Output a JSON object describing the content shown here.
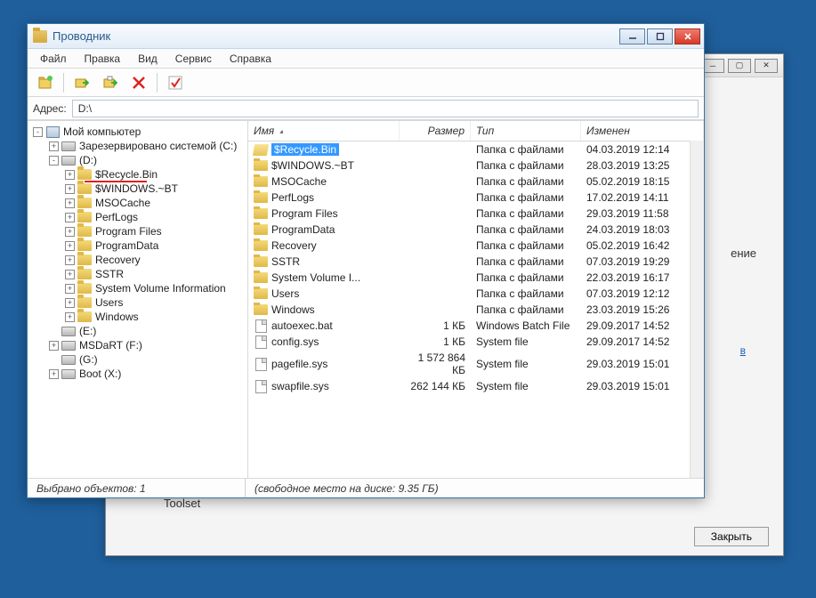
{
  "bg_window": {
    "text_fragment": "ение",
    "link_fragment": "в",
    "label": "Toolset",
    "close_btn": "Закрыть"
  },
  "window": {
    "title": "Проводник",
    "menu": [
      "Файл",
      "Правка",
      "Вид",
      "Сервис",
      "Справка"
    ],
    "address_label": "Адрес:",
    "address_value": "D:\\",
    "status_left": "Выбрано объектов: 1",
    "status_right": "(свободное место на диске: 9.35 ГБ)"
  },
  "tree": {
    "root": "Мой компьютер",
    "items": [
      {
        "label": "Зарезервировано системой (C:)",
        "type": "drive",
        "exp": "+",
        "indent": 1
      },
      {
        "label": "(D:)",
        "type": "drive",
        "exp": "-",
        "indent": 1
      },
      {
        "label": "$Recycle.Bin",
        "type": "folder",
        "exp": "+",
        "indent": 2,
        "red": true
      },
      {
        "label": "$WINDOWS.~BT",
        "type": "folder",
        "exp": "+",
        "indent": 2
      },
      {
        "label": "MSOCache",
        "type": "folder",
        "exp": "+",
        "indent": 2
      },
      {
        "label": "PerfLogs",
        "type": "folder",
        "exp": "+",
        "indent": 2
      },
      {
        "label": "Program Files",
        "type": "folder",
        "exp": "+",
        "indent": 2
      },
      {
        "label": "ProgramData",
        "type": "folder",
        "exp": "+",
        "indent": 2
      },
      {
        "label": "Recovery",
        "type": "folder",
        "exp": "+",
        "indent": 2
      },
      {
        "label": "SSTR",
        "type": "folder",
        "exp": "+",
        "indent": 2
      },
      {
        "label": "System Volume Information",
        "type": "folder",
        "exp": "+",
        "indent": 2
      },
      {
        "label": "Users",
        "type": "folder",
        "exp": "+",
        "indent": 2
      },
      {
        "label": "Windows",
        "type": "folder",
        "exp": "+",
        "indent": 2
      },
      {
        "label": "(E:)",
        "type": "drive",
        "exp": "",
        "indent": 1
      },
      {
        "label": "MSDaRT (F:)",
        "type": "drive",
        "exp": "+",
        "indent": 1
      },
      {
        "label": "(G:)",
        "type": "drive",
        "exp": "",
        "indent": 1
      },
      {
        "label": "Boot (X:)",
        "type": "drive",
        "exp": "+",
        "indent": 1
      }
    ]
  },
  "list": {
    "columns": {
      "name": "Имя",
      "size": "Размер",
      "type": "Тип",
      "modified": "Изменен"
    },
    "rows": [
      {
        "icon": "folder-open",
        "name": "$Recycle.Bin",
        "size": "",
        "type": "Папка с файлами",
        "mod": "04.03.2019 12:14",
        "selected": true
      },
      {
        "icon": "folder",
        "name": "$WINDOWS.~BT",
        "size": "",
        "type": "Папка с файлами",
        "mod": "28.03.2019 13:25"
      },
      {
        "icon": "folder",
        "name": "MSOCache",
        "size": "",
        "type": "Папка с файлами",
        "mod": "05.02.2019 18:15"
      },
      {
        "icon": "folder",
        "name": "PerfLogs",
        "size": "",
        "type": "Папка с файлами",
        "mod": "17.02.2019 14:11"
      },
      {
        "icon": "folder",
        "name": "Program Files",
        "size": "",
        "type": "Папка с файлами",
        "mod": "29.03.2019 11:58"
      },
      {
        "icon": "folder",
        "name": "ProgramData",
        "size": "",
        "type": "Папка с файлами",
        "mod": "24.03.2019 18:03"
      },
      {
        "icon": "folder",
        "name": "Recovery",
        "size": "",
        "type": "Папка с файлами",
        "mod": "05.02.2019 16:42"
      },
      {
        "icon": "folder",
        "name": "SSTR",
        "size": "",
        "type": "Папка с файлами",
        "mod": "07.03.2019 19:29"
      },
      {
        "icon": "folder",
        "name": "System Volume I...",
        "size": "",
        "type": "Папка с файлами",
        "mod": "22.03.2019 16:17"
      },
      {
        "icon": "folder",
        "name": "Users",
        "size": "",
        "type": "Папка с файлами",
        "mod": "07.03.2019 12:12"
      },
      {
        "icon": "folder",
        "name": "Windows",
        "size": "",
        "type": "Папка с файлами",
        "mod": "23.03.2019 15:26"
      },
      {
        "icon": "file",
        "name": "autoexec.bat",
        "size": "1 КБ",
        "type": "Windows Batch File",
        "mod": "29.09.2017 14:52"
      },
      {
        "icon": "file",
        "name": "config.sys",
        "size": "1 КБ",
        "type": "System file",
        "mod": "29.09.2017 14:52"
      },
      {
        "icon": "file",
        "name": "pagefile.sys",
        "size": "1 572 864 КБ",
        "type": "System file",
        "mod": "29.03.2019 15:01"
      },
      {
        "icon": "file",
        "name": "swapfile.sys",
        "size": "262 144 КБ",
        "type": "System file",
        "mod": "29.03.2019 15:01"
      }
    ]
  }
}
